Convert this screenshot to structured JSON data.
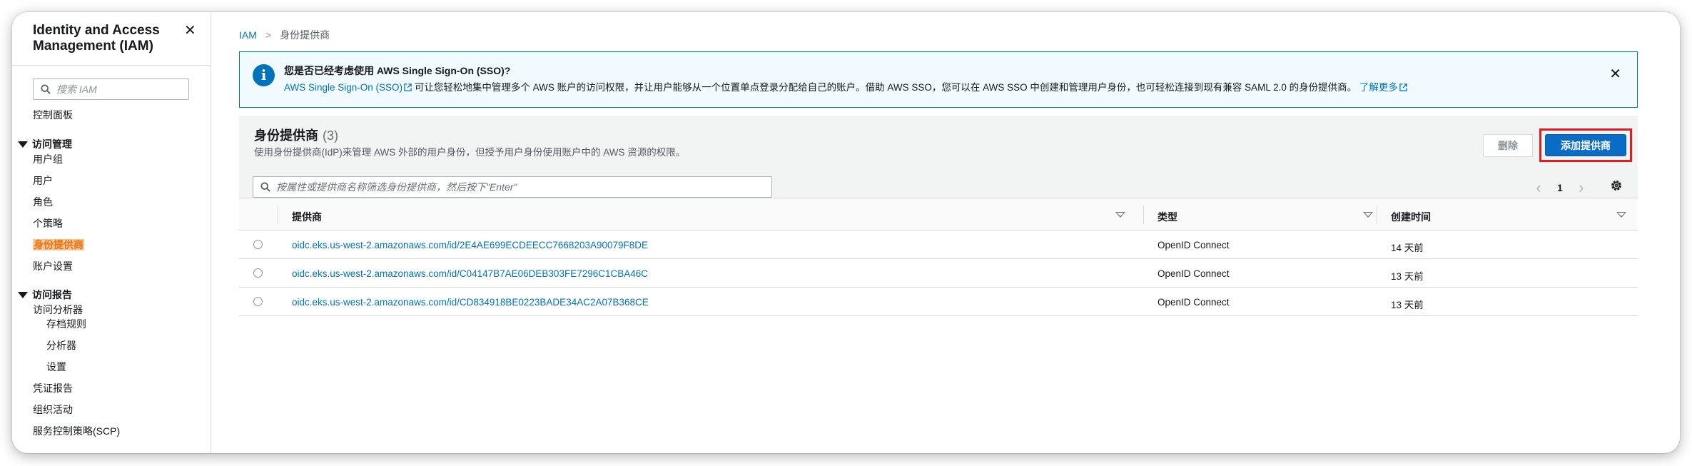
{
  "sidebar": {
    "title": "Identity and Access Management (IAM)",
    "search_placeholder": "搜索 IAM",
    "dashboard": "控制面板",
    "access_management": {
      "label": "访问管理",
      "items": [
        "用户组",
        "用户",
        "角色",
        "个策略",
        "身份提供商",
        "账户设置"
      ]
    },
    "access_reports": {
      "label": "访问报告",
      "analyzer": "访问分析器",
      "analyzer_items": [
        "存档规则",
        "分析器",
        "设置"
      ],
      "items": [
        "凭证报告",
        "组织活动",
        "服务控制策略(SCP)"
      ]
    }
  },
  "breadcrumb": {
    "root": "IAM",
    "current": "身份提供商"
  },
  "flash": {
    "title": "您是否已经考虑使用 AWS Single Sign-On (SSO)?",
    "link": "AWS Single Sign-On (SSO)",
    "body": "可让您轻松地集中管理多个 AWS 账户的访问权限，并让用户能够从一个位置单点登录分配给自己的账户。借助 AWS SSO，您可以在 AWS SSO 中创建和管理用户身份，也可轻松连接到现有兼容 SAML 2.0 的身份提供商。",
    "learn_more": "了解更多"
  },
  "panel": {
    "title": "身份提供商",
    "count": "(3)",
    "description": "使用身份提供商(IdP)来管理 AWS 外部的用户身份，但授予用户身份使用账户中的 AWS 资源的权限。",
    "delete_label": "删除",
    "add_label": "添加提供商",
    "filter_placeholder": "按属性或提供商名称筛选身份提供商，然后按下\"Enter\"",
    "page": "1"
  },
  "table": {
    "columns": [
      "提供商",
      "类型",
      "创建时间"
    ],
    "rows": [
      {
        "provider": "oidc.eks.us-west-2.amazonaws.com/id/2E4AE699ECDEECC7668203A90079F8DE",
        "type": "OpenID Connect",
        "created": "14 天前"
      },
      {
        "provider": "oidc.eks.us-west-2.amazonaws.com/id/C04147B7AE06DEB303FE7296C1CBA46C",
        "type": "OpenID Connect",
        "created": "13 天前"
      },
      {
        "provider": "oidc.eks.us-west-2.amazonaws.com/id/CD834918BE0223BADE34AC2A07B368CE",
        "type": "OpenID Connect",
        "created": "13 天前"
      }
    ]
  },
  "colors": {
    "accent": "#0073bb",
    "primary_button": "#0b6cc6",
    "active_nav": "#ec7211",
    "highlight_box": "#e31b23"
  }
}
